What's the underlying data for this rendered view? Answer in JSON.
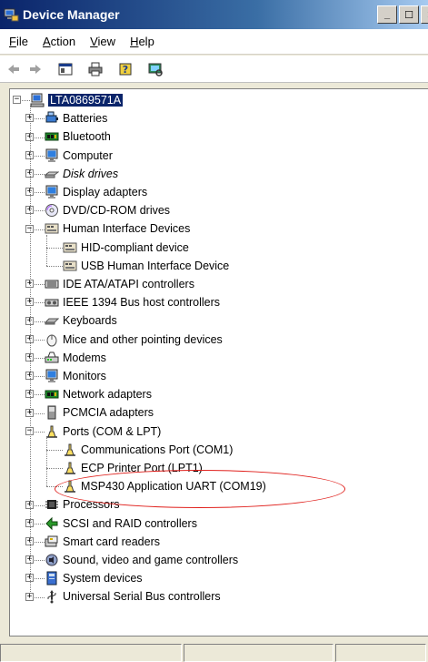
{
  "window": {
    "title": "Device Manager",
    "min_label": "_",
    "max_label": "☐",
    "close_label": "✕"
  },
  "menu": {
    "file": "F",
    "file_rest": "ile",
    "action": "A",
    "action_rest": "ction",
    "view": "V",
    "view_rest": "iew",
    "help": "H",
    "help_rest": "elp"
  },
  "tree": {
    "root": "LTA0869571A",
    "items": [
      {
        "label": "Batteries",
        "icon": "battery-icon",
        "expanded": false,
        "italic": false
      },
      {
        "label": "Bluetooth",
        "icon": "bluetooth-chip-icon",
        "expanded": false,
        "italic": false
      },
      {
        "label": "Computer",
        "icon": "computer-icon",
        "expanded": false,
        "italic": false
      },
      {
        "label": "Disk drives",
        "icon": "disk-drive-icon",
        "expanded": false,
        "italic": true
      },
      {
        "label": "Display adapters",
        "icon": "display-adapter-icon",
        "expanded": false,
        "italic": false
      },
      {
        "label": "DVD/CD-ROM drives",
        "icon": "dvd-drive-icon",
        "expanded": false,
        "italic": false
      },
      {
        "label": "Human Interface Devices",
        "icon": "hid-icon",
        "expanded": true,
        "italic": false,
        "children": [
          "HID-compliant device",
          "USB Human Interface Device"
        ]
      },
      {
        "label": "IDE ATA/ATAPI controllers",
        "icon": "ide-controller-icon",
        "expanded": false,
        "italic": false
      },
      {
        "label": "IEEE 1394 Bus host controllers",
        "icon": "firewire-icon",
        "expanded": false,
        "italic": false
      },
      {
        "label": "Keyboards",
        "icon": "keyboard-icon",
        "expanded": false,
        "italic": false
      },
      {
        "label": "Mice and other pointing devices",
        "icon": "mouse-icon",
        "expanded": false,
        "italic": false
      },
      {
        "label": "Modems",
        "icon": "modem-icon",
        "expanded": false,
        "italic": false
      },
      {
        "label": "Monitors",
        "icon": "monitor-icon",
        "expanded": false,
        "italic": false
      },
      {
        "label": "Network adapters",
        "icon": "network-adapter-icon",
        "expanded": false,
        "italic": false
      },
      {
        "label": "PCMCIA adapters",
        "icon": "pcmcia-icon",
        "expanded": false,
        "italic": false
      },
      {
        "label": "Ports (COM & LPT)",
        "icon": "port-icon",
        "expanded": true,
        "italic": false,
        "children": [
          "Communications Port (COM1)",
          "ECP Printer Port (LPT1)",
          "MSP430 Application UART (COM19)"
        ]
      },
      {
        "label": "Processors",
        "icon": "processor-icon",
        "expanded": false,
        "italic": false
      },
      {
        "label": "SCSI and RAID controllers",
        "icon": "scsi-icon",
        "expanded": false,
        "italic": false
      },
      {
        "label": "Smart card readers",
        "icon": "smart-card-icon",
        "expanded": false,
        "italic": false
      },
      {
        "label": "Sound, video and game controllers",
        "icon": "sound-icon",
        "expanded": false,
        "italic": false
      },
      {
        "label": "System devices",
        "icon": "system-device-icon",
        "expanded": false,
        "italic": false
      },
      {
        "label": "Universal Serial Bus controllers",
        "icon": "usb-icon",
        "expanded": false,
        "italic": false
      }
    ]
  },
  "annotation": {
    "color": "#e0201c"
  }
}
